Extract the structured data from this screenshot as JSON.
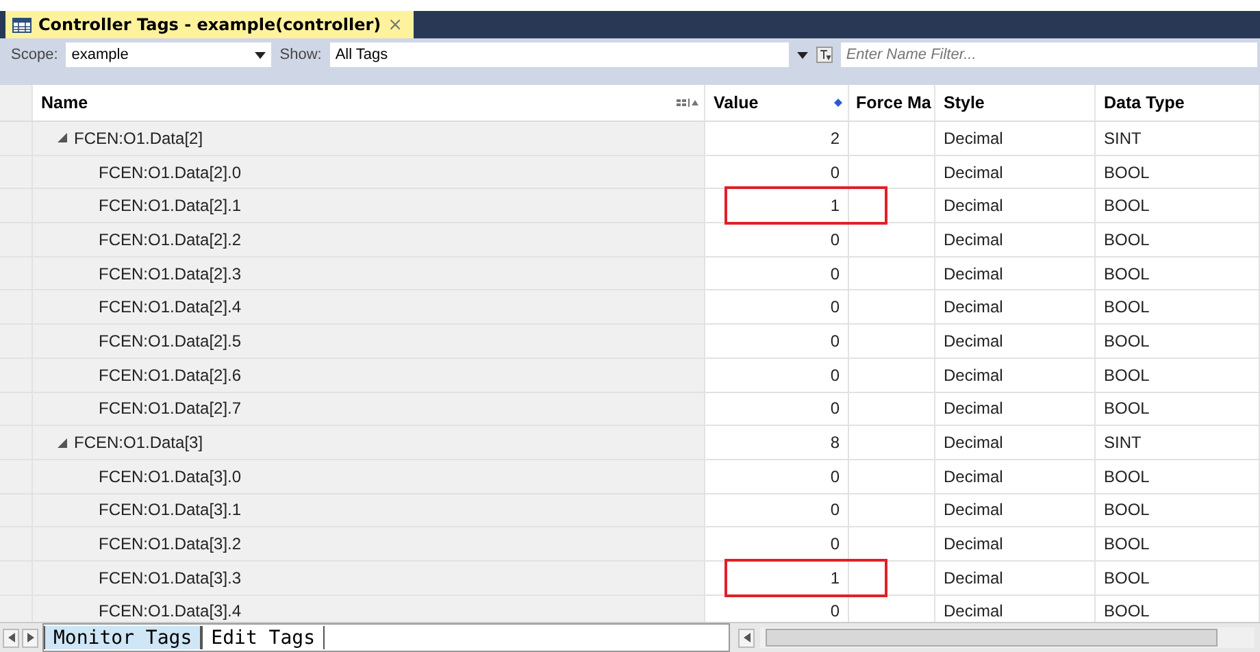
{
  "tab": {
    "title": "Controller Tags - example(controller)",
    "close": "×"
  },
  "toolbar": {
    "scope_label": "Scope:",
    "scope_value": "example",
    "show_label": "Show:",
    "show_value": "All Tags",
    "filter": {
      "placeholder": "Enter Name Filter..."
    }
  },
  "table": {
    "columns": [
      "Name",
      "Value",
      "Force Ma",
      "Style",
      "Data Type"
    ],
    "rows": [
      {
        "name": "FCEN:O1.Data[2]",
        "expanded": true,
        "value": "2",
        "style": "Decimal",
        "data_type": "SINT",
        "highlighted": false,
        "children": [
          {
            "name": "FCEN:O1.Data[2].0",
            "value": "0",
            "style": "Decimal",
            "data_type": "BOOL",
            "highlighted": false
          },
          {
            "name": "FCEN:O1.Data[2].1",
            "value": "1",
            "style": "Decimal",
            "data_type": "BOOL",
            "highlighted": true
          },
          {
            "name": "FCEN:O1.Data[2].2",
            "value": "0",
            "style": "Decimal",
            "data_type": "BOOL",
            "highlighted": false
          },
          {
            "name": "FCEN:O1.Data[2].3",
            "value": "0",
            "style": "Decimal",
            "data_type": "BOOL",
            "highlighted": false
          },
          {
            "name": "FCEN:O1.Data[2].4",
            "value": "0",
            "style": "Decimal",
            "data_type": "BOOL",
            "highlighted": false
          },
          {
            "name": "FCEN:O1.Data[2].5",
            "value": "0",
            "style": "Decimal",
            "data_type": "BOOL",
            "highlighted": false
          },
          {
            "name": "FCEN:O1.Data[2].6",
            "value": "0",
            "style": "Decimal",
            "data_type": "BOOL",
            "highlighted": false
          },
          {
            "name": "FCEN:O1.Data[2].7",
            "value": "0",
            "style": "Decimal",
            "data_type": "BOOL",
            "highlighted": false
          }
        ]
      },
      {
        "name": "FCEN:O1.Data[3]",
        "expanded": true,
        "value": "8",
        "style": "Decimal",
        "data_type": "SINT",
        "highlighted": false,
        "children": [
          {
            "name": "FCEN:O1.Data[3].0",
            "value": "0",
            "style": "Decimal",
            "data_type": "BOOL",
            "highlighted": false
          },
          {
            "name": "FCEN:O1.Data[3].1",
            "value": "0",
            "style": "Decimal",
            "data_type": "BOOL",
            "highlighted": false
          },
          {
            "name": "FCEN:O1.Data[3].2",
            "value": "0",
            "style": "Decimal",
            "data_type": "BOOL",
            "highlighted": false
          },
          {
            "name": "FCEN:O1.Data[3].3",
            "value": "1",
            "style": "Decimal",
            "data_type": "BOOL",
            "highlighted": true
          },
          {
            "name": "FCEN:O1.Data[3].4",
            "value": "0",
            "style": "Decimal",
            "data_type": "BOOL",
            "highlighted": false
          }
        ]
      }
    ]
  },
  "bottom_tabs": [
    {
      "label": "Monitor Tags",
      "selected": true
    },
    {
      "label": "Edit Tags",
      "selected": false
    }
  ]
}
